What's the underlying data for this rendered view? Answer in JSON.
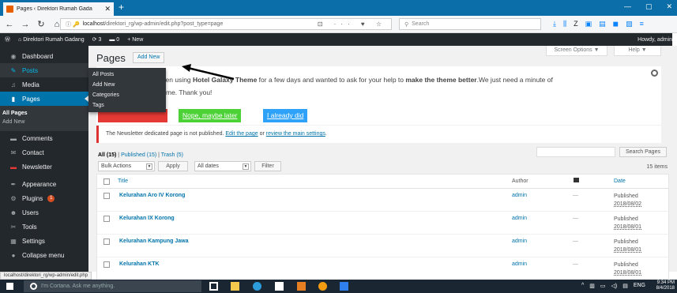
{
  "browser": {
    "tab_title": "Pages ‹ Direktori Rumah Gada",
    "url_prefix": "ⓘ 🔑",
    "url_host": "localhost",
    "url_path": "/direktori_rg/wp-admin/edit.php?post_type=page",
    "search_placeholder": "Search",
    "status_url": "localhost/direktori_rg/wp-admin/edit.php"
  },
  "adminbar": {
    "site_name": "Direktori Rumah Gadang",
    "updates": "3",
    "comments": "0",
    "new_label": "New",
    "howdy": "Howdy, admin"
  },
  "sidebar": {
    "items": [
      {
        "label": "Dashboard",
        "icon": "dashboard-icon"
      },
      {
        "label": "Posts",
        "icon": "pin-icon"
      },
      {
        "label": "Media",
        "icon": "media-icon"
      },
      {
        "label": "Pages",
        "icon": "pages-icon"
      },
      {
        "label": "Comments",
        "icon": "comment-icon"
      },
      {
        "label": "Contact",
        "icon": "mail-icon"
      },
      {
        "label": "Newsletter",
        "icon": "newsletter-icon"
      },
      {
        "label": "Appearance",
        "icon": "brush-icon"
      },
      {
        "label": "Plugins",
        "icon": "plugin-icon"
      },
      {
        "label": "Users",
        "icon": "users-icon"
      },
      {
        "label": "Tools",
        "icon": "wrench-icon"
      },
      {
        "label": "Settings",
        "icon": "settings-icon"
      },
      {
        "label": "Collapse menu",
        "icon": "collapse-icon"
      }
    ],
    "pages_sub": [
      "All Pages",
      "Add New"
    ],
    "plugins_badge": "1"
  },
  "flyout": [
    "All Posts",
    "Add New",
    "Categories",
    "Tags"
  ],
  "content": {
    "screen_options": "Screen Options ▼",
    "help": "Help ▼",
    "title": "Pages",
    "add_new": "Add New",
    "notice_line1_pre": "ave been using",
    "notice_theme": "Hotel Galaxy Theme",
    "notice_line1_mid": " for a few days and wanted to ask for your help to ",
    "notice_bold2": "make the theme better",
    "notice_line1_post": ".We just need a minute of",
    "notice_line2": "the theme. Thank you!",
    "btn_later": "Nope, maybe later",
    "btn_already": "I already did",
    "newsletter_pre": "The Newsletter dedicated page is not published. ",
    "newsletter_link1": "Edit the page",
    "newsletter_mid": " or ",
    "newsletter_link2": "review the main settings",
    "newsletter_post": ".",
    "filter_all": "All (15)",
    "filter_published": "Published (15)",
    "filter_trash": "Trash (5)",
    "search_button": "Search Pages",
    "bulk_actions": "Bulk Actions",
    "apply": "Apply",
    "all_dates": "All dates",
    "filter_btn": "Filter",
    "items_count": "15 items"
  },
  "table": {
    "headers": {
      "title": "Title",
      "author": "Author",
      "date": "Date"
    },
    "rows": [
      {
        "title": "Kelurahan Aro IV Korong",
        "author": "admin",
        "comments": "—",
        "status": "Published",
        "date": "2018/08/02"
      },
      {
        "title": "Kelurahan IX Korong",
        "author": "admin",
        "comments": "—",
        "status": "Published",
        "date": "2018/08/01"
      },
      {
        "title": "Kelurahan Kampung Jawa",
        "author": "admin",
        "comments": "—",
        "status": "Published",
        "date": "2018/08/01"
      },
      {
        "title": "Kelurahan KTK",
        "author": "admin",
        "comments": "—",
        "status": "Published",
        "date": "2018/08/01"
      }
    ]
  },
  "taskbar": {
    "cortana": "I'm Cortana. Ask me anything.",
    "lang": "ENG",
    "time": "9:34 PM",
    "date": "8/4/2018"
  },
  "colors": {
    "wp_dark": "#23282d",
    "wp_blue": "#0073aa",
    "notice_red": "#dc3232",
    "btn_green": "#4cd137",
    "btn_blue": "#2ea2f8"
  }
}
